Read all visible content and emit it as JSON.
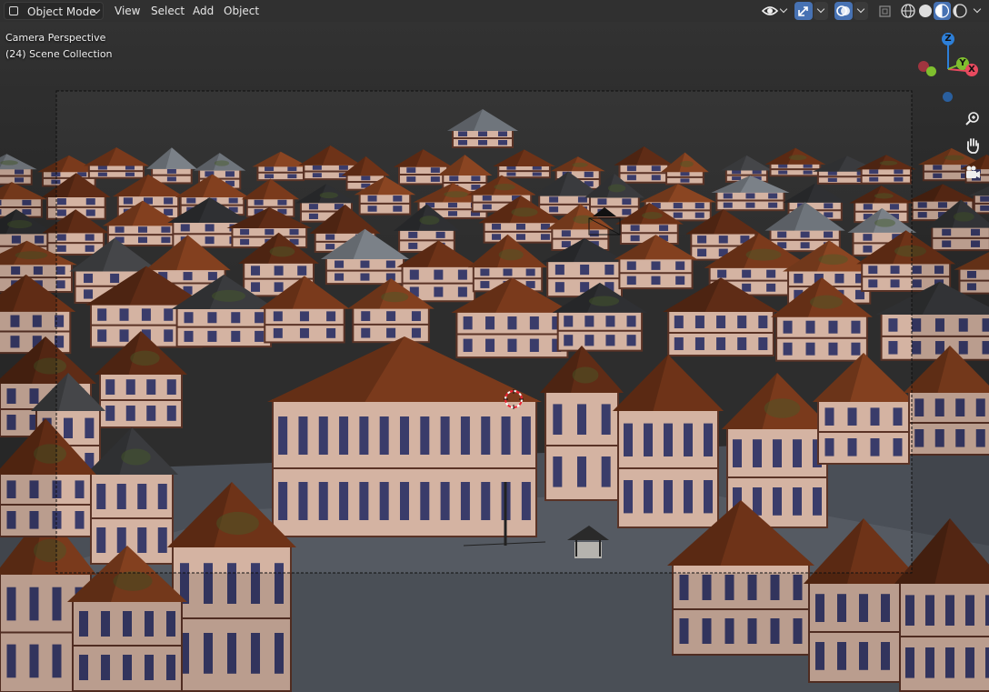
{
  "header": {
    "mode_label": "Object Mode",
    "menus": [
      "View",
      "Select",
      "Add",
      "Object"
    ]
  },
  "viewport": {
    "perspective_label": "Camera Perspective",
    "collection_label": "(24) Scene Collection"
  },
  "gizmo": {
    "z_label": "Z",
    "y_label": "Y",
    "x_label": "X"
  },
  "colors": {
    "x_axis": "#e84a5f",
    "y_axis": "#7fbf2e",
    "z_axis": "#2d7fd8",
    "accent": "#4772b3",
    "roof": "#7a3a1c",
    "plaster": "#d7b8a6"
  }
}
